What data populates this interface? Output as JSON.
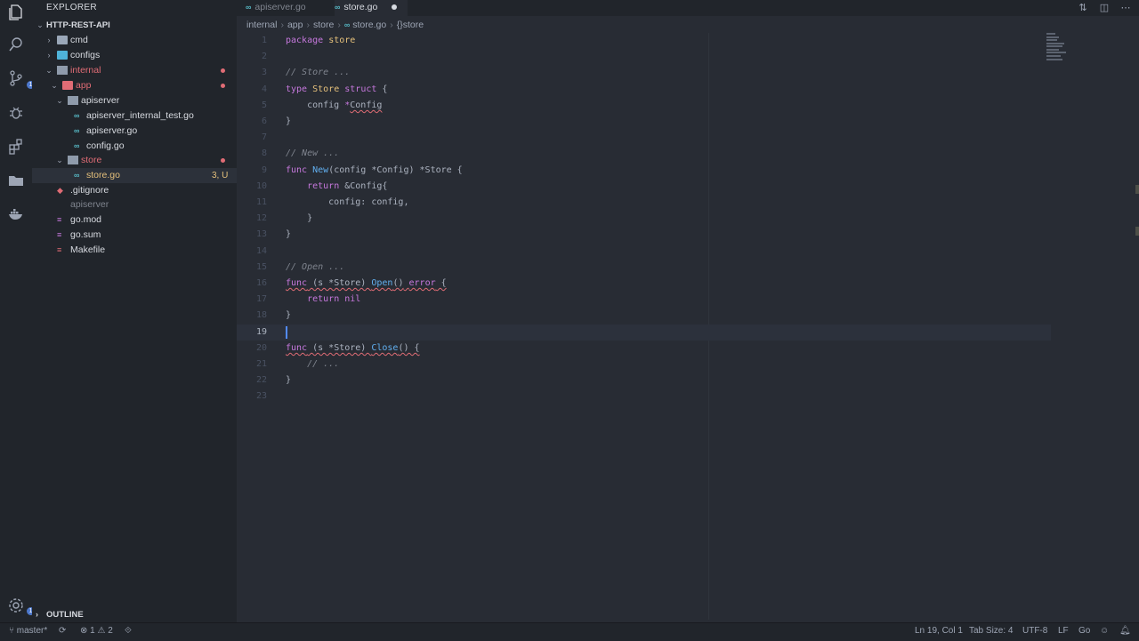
{
  "sidebar": {
    "title": "EXPLORER",
    "project": "HTTP-REST-API",
    "tree": [
      {
        "label": "cmd"
      },
      {
        "label": "configs"
      },
      {
        "label": "internal"
      },
      {
        "label": "app"
      },
      {
        "label": "apiserver"
      },
      {
        "label": "apiserver_internal_test.go"
      },
      {
        "label": "apiserver.go"
      },
      {
        "label": "config.go"
      },
      {
        "label": "store"
      },
      {
        "label": "store.go",
        "decoration": "3, U"
      },
      {
        "label": ".gitignore"
      },
      {
        "label": "apiserver"
      },
      {
        "label": "go.mod"
      },
      {
        "label": "go.sum"
      },
      {
        "label": "Makefile"
      }
    ],
    "outline": "OUTLINE"
  },
  "tabs": [
    {
      "label": "apiserver.go"
    },
    {
      "label": "store.go"
    }
  ],
  "breadcrumb": [
    "internal",
    "app",
    "store",
    "store.go",
    "{}store"
  ],
  "code": {
    "line_numbers": [
      "1",
      "2",
      "3",
      "4",
      "5",
      "6",
      "7",
      "8",
      "9",
      "10",
      "11",
      "12",
      "13",
      "14",
      "15",
      "16",
      "17",
      "18",
      "19",
      "20",
      "21",
      "22",
      "23"
    ],
    "t": {
      "package": "package",
      "store": "store",
      "c3": "// Store ...",
      "type": "type",
      "Store": "Store",
      "struct": "struct",
      "brace_open": " {",
      "config_field": "    config ",
      "star": "*",
      "Config": "Config",
      "brace_close": "}",
      "c8": "// New ...",
      "func": "func",
      "New": "New",
      "new_params": "(config *Config) *Store {",
      "ret_ind": "    ",
      "return": "return",
      "amp_config": " &Config{",
      "config_assign": "        config: config,",
      "inner_close": "    }",
      "c15": "// Open ...",
      "recv": " (s *Store) ",
      "Open": "Open",
      "parens": "()",
      "error": "error",
      "nil": "nil",
      "Close": "Close",
      "close_tail": "() {",
      "c21": "    // ..."
    }
  },
  "status": {
    "branch": "master*",
    "errors": "1",
    "warnings": "2",
    "position": "Ln 19, Col 1",
    "tab_size": "Tab Size: 4",
    "encoding": "UTF-8",
    "eol": "LF",
    "language": "Go"
  }
}
